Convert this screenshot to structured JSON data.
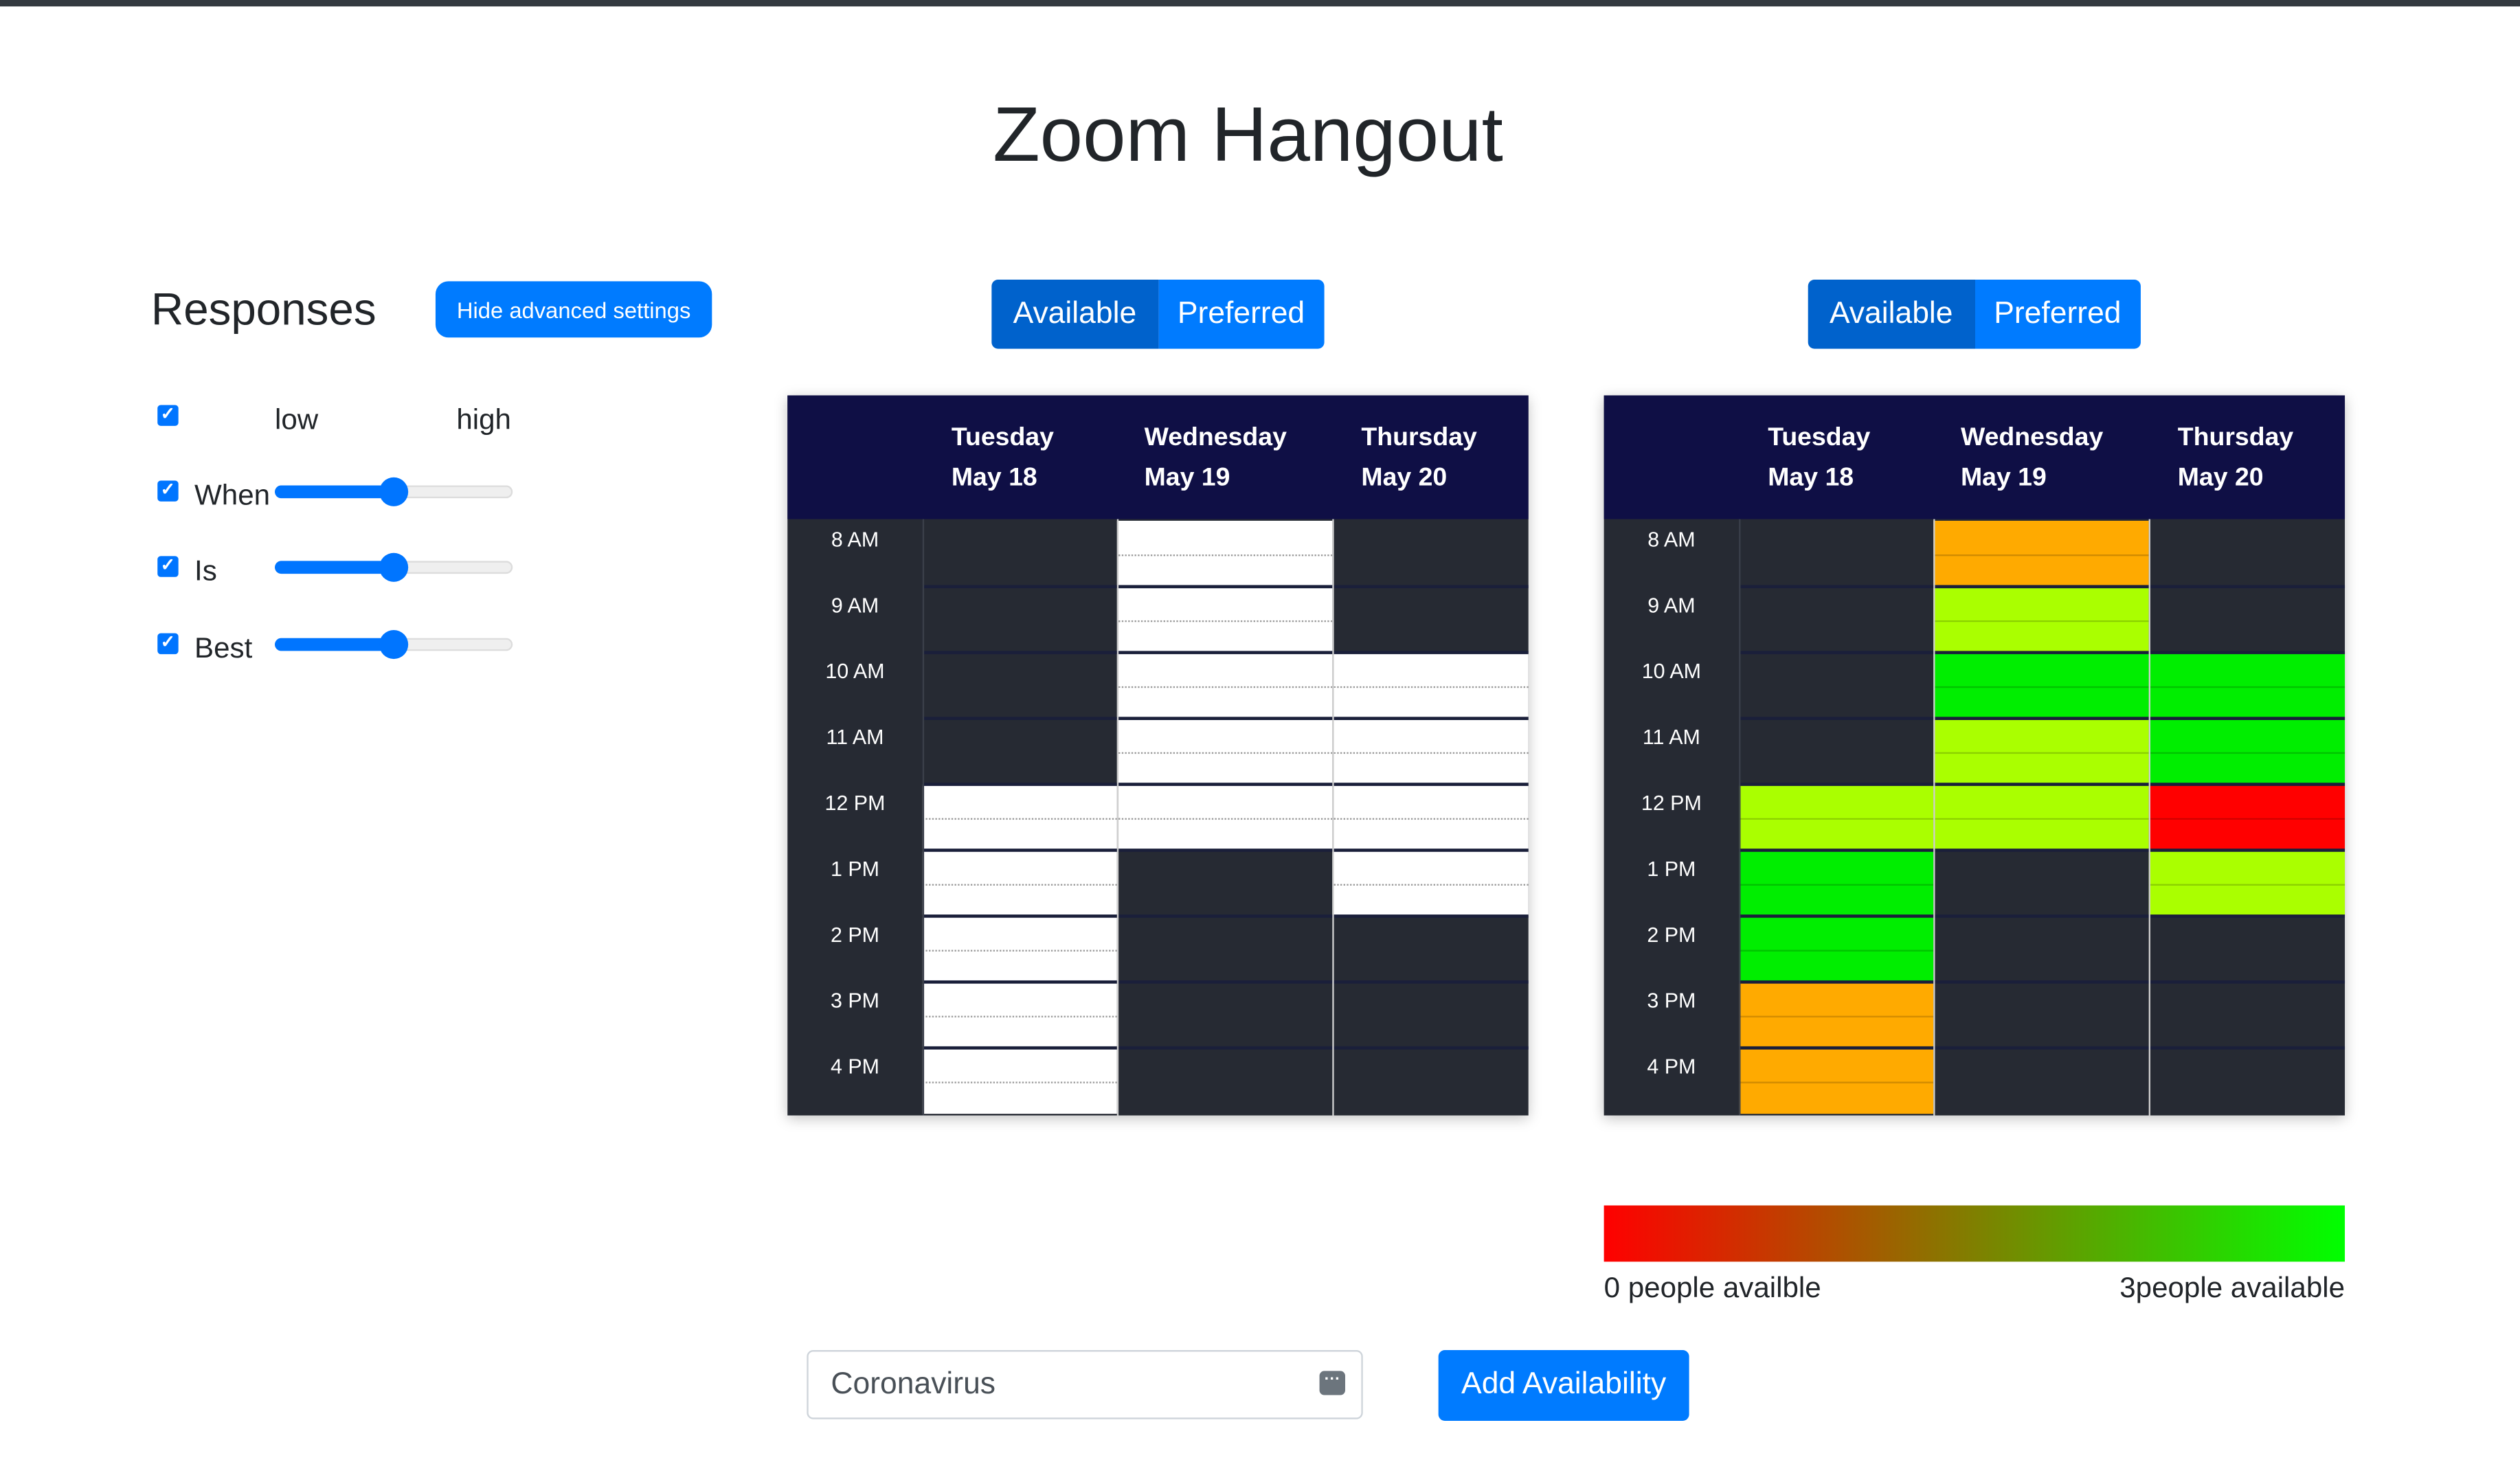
{
  "page": {
    "title": "Zoom Hangout"
  },
  "sidebar": {
    "title": "Responses",
    "toggle_button": "Hide advanced settings",
    "scale": {
      "low": "low",
      "high": "high",
      "checked": true
    },
    "filters": [
      {
        "label": "When",
        "checked": true,
        "value": 0.5
      },
      {
        "label": "Is",
        "checked": true,
        "value": 0.5
      },
      {
        "label": "Best",
        "checked": true,
        "value": 0.5
      }
    ]
  },
  "view_toggle": {
    "available": "Available",
    "preferred": "Preferred",
    "selected": "Available"
  },
  "schedule": {
    "days": [
      {
        "weekday": "Tuesday",
        "date": "May 18"
      },
      {
        "weekday": "Wednesday",
        "date": "May 19"
      },
      {
        "weekday": "Thursday",
        "date": "May 20"
      }
    ],
    "times": [
      "8 AM",
      "9 AM",
      "10 AM",
      "11 AM",
      "12 PM",
      "1 PM",
      "2 PM",
      "3 PM",
      "4 PM"
    ]
  },
  "my_availability": [
    [
      0,
      0,
      0,
      0,
      1,
      1,
      1,
      1,
      1
    ],
    [
      1,
      1,
      1,
      1,
      1,
      0,
      0,
      0,
      0
    ],
    [
      0,
      0,
      1,
      1,
      1,
      1,
      0,
      0,
      0
    ]
  ],
  "group_availability": [
    [
      null,
      null,
      null,
      null,
      "#aaff00",
      "#00ee00",
      "#00ee00",
      "#ffaa00",
      "#ffaa00"
    ],
    [
      "#ffaa00",
      "#aaff00",
      "#00ee00",
      "#aaff00",
      "#aaff00",
      null,
      null,
      null,
      null
    ],
    [
      null,
      null,
      "#00ee00",
      "#00ee00",
      "#ff0000",
      "#aaff00",
      null,
      null,
      null
    ]
  ],
  "legend": {
    "low_label": "0 people availble",
    "high_label": "3people available",
    "low_color": "#ff0000",
    "high_color": "#00ff00"
  },
  "form": {
    "name_value": "Coronavirus",
    "submit_label": "Add Availability"
  },
  "colors": {
    "accent": "#007bff",
    "accent_active": "#0062cc",
    "grid_header": "#0f0f45",
    "grid_body": "#262a33"
  }
}
